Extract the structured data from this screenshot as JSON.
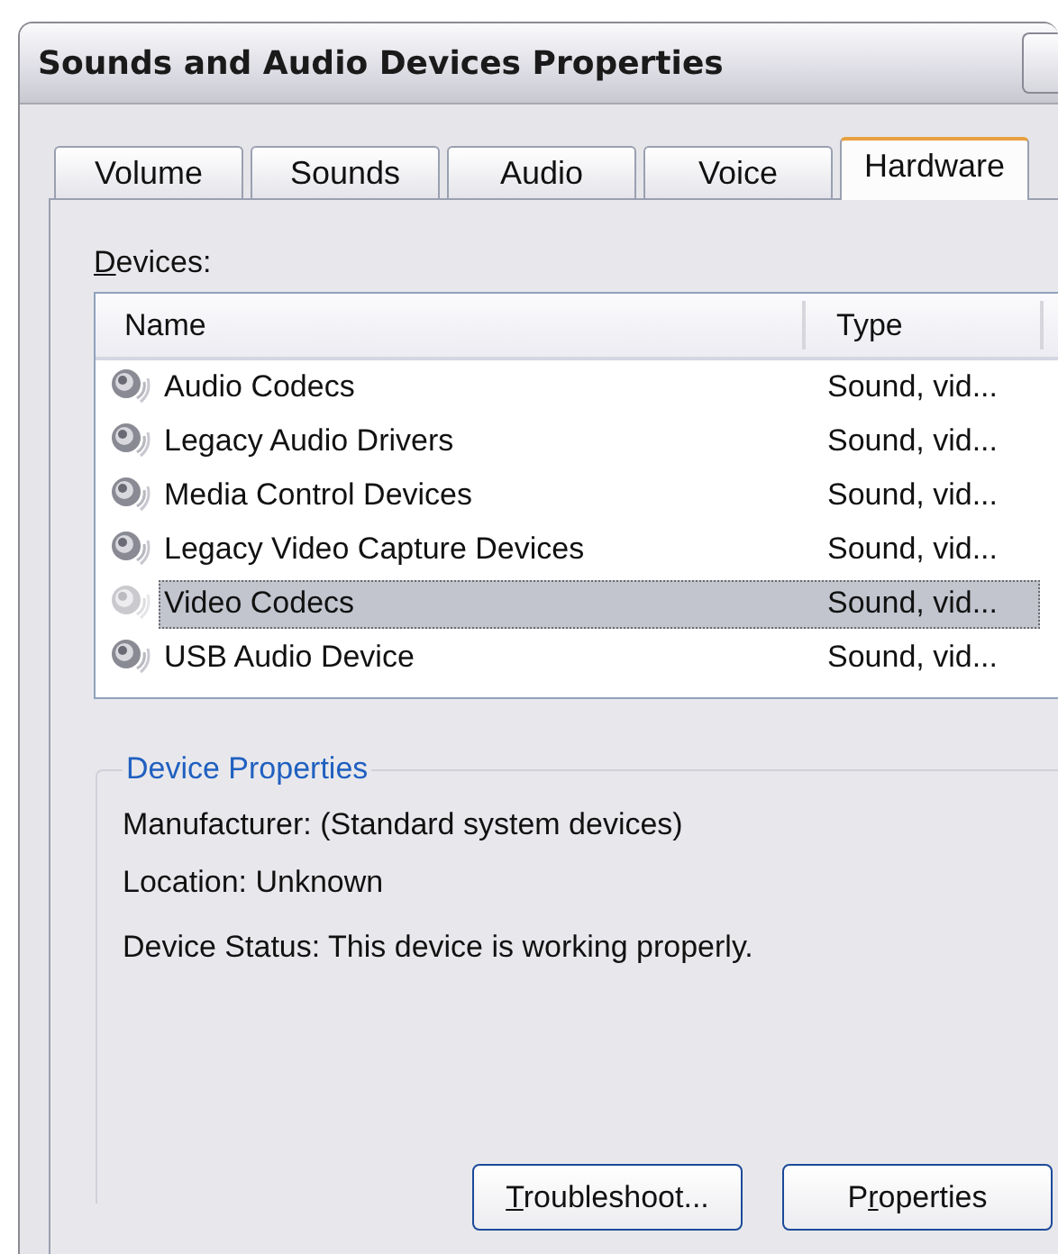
{
  "window": {
    "title": "Sounds and Audio Devices Properties"
  },
  "tabs": [
    {
      "label": "Volume",
      "selected": false
    },
    {
      "label": "Sounds",
      "selected": false
    },
    {
      "label": "Audio",
      "selected": false
    },
    {
      "label": "Voice",
      "selected": false
    },
    {
      "label": "Hardware",
      "selected": true
    }
  ],
  "devices": {
    "label": [
      {
        "text": "D",
        "underlined": true
      },
      {
        "text": "evices:",
        "underlined": false
      }
    ],
    "columns": [
      "Name",
      "Type"
    ],
    "rows": [
      {
        "name": "Audio Codecs",
        "type": "Sound, vid...",
        "selected": false
      },
      {
        "name": "Legacy Audio Drivers",
        "type": "Sound, vid...",
        "selected": false
      },
      {
        "name": "Media Control Devices",
        "type": "Sound, vid...",
        "selected": false
      },
      {
        "name": "Legacy Video Capture Devices",
        "type": "Sound, vid...",
        "selected": false
      },
      {
        "name": "Video Codecs",
        "type": "Sound, vid...",
        "selected": true
      },
      {
        "name": "USB Audio Device",
        "type": "Sound, vid...",
        "selected": false
      }
    ]
  },
  "device_properties": {
    "title": "Device Properties",
    "lines": [
      "Manufacturer: (Standard system devices)",
      "Location: Unknown",
      "Device Status: This device is working properly."
    ]
  },
  "buttons": [
    {
      "label": [
        {
          "text": "T",
          "underlined": true
        },
        {
          "text": "roubleshoot...",
          "underlined": false
        }
      ]
    },
    {
      "label": [
        {
          "text": "P",
          "underlined": false
        },
        {
          "text": "r",
          "underlined": true
        },
        {
          "text": "operties",
          "underlined": false
        }
      ]
    }
  ]
}
